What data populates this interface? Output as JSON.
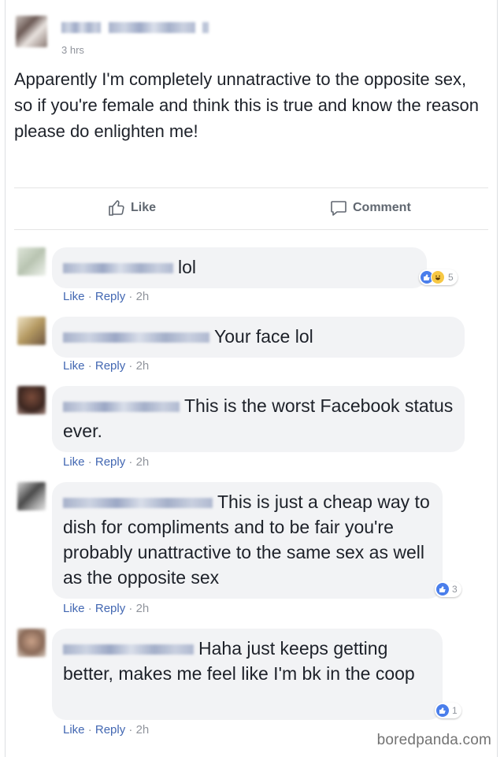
{
  "post": {
    "timestamp": "3 hrs",
    "text": "Apparently I'm completely unnatractive to the opposite sex, so if you're female and think this is true and know the reason please do enlighten me!"
  },
  "actions": {
    "like": "Like",
    "comment": "Comment"
  },
  "comments": [
    {
      "text": "lol",
      "reactions": "5",
      "like": "Like",
      "reply": "Reply",
      "sep": "·",
      "time": "2h"
    },
    {
      "text": "Your face lol",
      "like": "Like",
      "reply": "Reply",
      "sep": "·",
      "time": "2h"
    },
    {
      "text": "This is the worst Facebook status ever.",
      "like": "Like",
      "reply": "Reply",
      "sep": "·",
      "time": "2h"
    },
    {
      "text": "This is just a cheap way to dish for compliments and to be fair you're probably unattractive to the same sex as well as the opposite sex",
      "reactions": "3",
      "like": "Like",
      "reply": "Reply",
      "sep": "·",
      "time": "2h"
    },
    {
      "text": "Haha just keeps getting better, makes me feel like I'm bk in the coop",
      "reactions": "1",
      "like": "Like",
      "reply": "Reply",
      "sep": "·",
      "time": "2h"
    }
  ],
  "watermark": "boredpanda.com",
  "colors": {
    "link": "#4267b2",
    "bubble": "#f2f3f5",
    "like_blue": "#4a7eeb",
    "muted": "#90949c"
  },
  "icons": [
    "thumbs-up-icon",
    "comment-icon",
    "like-reaction-icon",
    "haha-reaction-icon"
  ]
}
